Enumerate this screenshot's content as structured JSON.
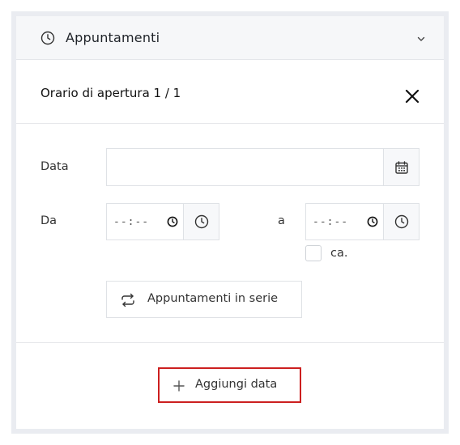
{
  "accordion": {
    "title": "Appuntamenti"
  },
  "section": {
    "title": "Orario di apertura 1 / 1"
  },
  "form": {
    "date_label": "Data",
    "date_value": "",
    "from_label": "Da",
    "from_value": "--:--",
    "to_label": "a",
    "to_value": "--:--",
    "approx_label": "ca."
  },
  "buttons": {
    "series_label": "Appuntamenti in serie",
    "add_date_label": "Aggiungi data"
  },
  "colors": {
    "add_button_border": "#cc1f1f"
  }
}
